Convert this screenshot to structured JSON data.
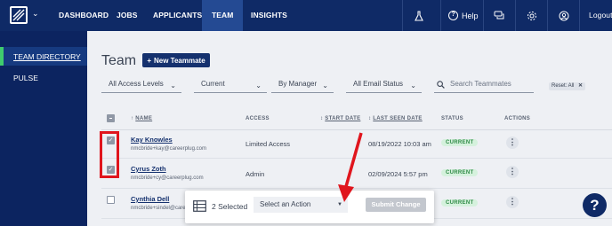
{
  "nav": {
    "items": [
      "DASHBOARD",
      "JOBS",
      "APPLICANTS",
      "TEAM",
      "INSIGHTS"
    ],
    "help_label": "Help",
    "logout_label": "Logout"
  },
  "sidebar": {
    "items": [
      "TEAM DIRECTORY",
      "PULSE"
    ]
  },
  "page": {
    "title": "Team",
    "new_button": "New Teammate"
  },
  "filters": {
    "access": "All Access Levels",
    "current": "Current",
    "by_manager": "By Manager",
    "email_status": "All Email Status",
    "search_placeholder": "Search Teammates",
    "reset": "Reset: All"
  },
  "table": {
    "headers": {
      "name": "NAME",
      "access": "ACCESS",
      "start_date": "START DATE",
      "last_seen": "LAST SEEN DATE",
      "status": "STATUS",
      "actions": "ACTIONS"
    },
    "rows": [
      {
        "name": "Kay Knowles",
        "email": "nmcbride+kay@careerplug.com",
        "access": "Limited Access",
        "start": "",
        "last_seen": "08/19/2022 10:03 am",
        "status": "CURRENT",
        "checked": true
      },
      {
        "name": "Cyrus Zoth",
        "email": "nmcbride+cy@careerplug.com",
        "access": "Admin",
        "start": "",
        "last_seen": "02/09/2024 5:57 pm",
        "status": "CURRENT",
        "checked": true
      },
      {
        "name": "Cynthia Dell",
        "email": "nmcbride+sindel@careerp...",
        "access": "",
        "start": "",
        "last_seen": "",
        "status": "CURRENT",
        "checked": false
      }
    ]
  },
  "bulk": {
    "count_label": "2 Selected",
    "select_label": "Select an Action",
    "submit_label": "Submit Change"
  },
  "colors": {
    "nav_bg": "#0f2a66",
    "accent_green": "#3fcc6e",
    "highlight_red": "#e0151d"
  }
}
